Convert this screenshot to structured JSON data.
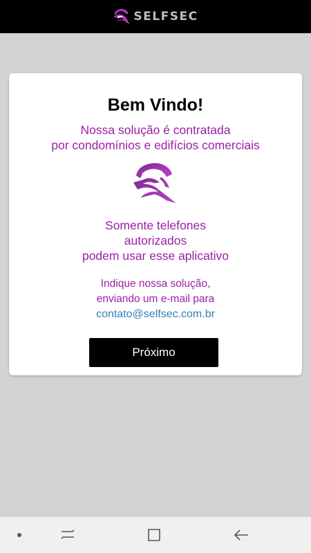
{
  "header": {
    "brand_text": "SELFSEC",
    "logo_icon": "selfsec-helmet-logo-icon"
  },
  "card": {
    "title": "Bem Vindo!",
    "intro_lines": [
      "Nossa solução é contratada",
      "por condomínios e edifícios comerciais"
    ],
    "logo_icon": "selfsec-helmet-logo-icon",
    "auth_lines": [
      "Somente telefones",
      "autorizados",
      "podem usar esse aplicativo"
    ],
    "indique_lines": [
      "Indique nossa solução,",
      "enviando um e-mail para"
    ],
    "email": "contato@selfsec.com.br",
    "next_button_label": "Próximo"
  },
  "navbar": {
    "items": [
      {
        "icon": "dot-icon"
      },
      {
        "icon": "recent-apps-icon"
      },
      {
        "icon": "home-icon"
      },
      {
        "icon": "back-arrow-icon"
      }
    ]
  },
  "colors": {
    "accent_purple": "#9b1fa8",
    "link_blue": "#2f7fb8",
    "button_black": "#000000",
    "background_gray": "#d3d3d3"
  }
}
